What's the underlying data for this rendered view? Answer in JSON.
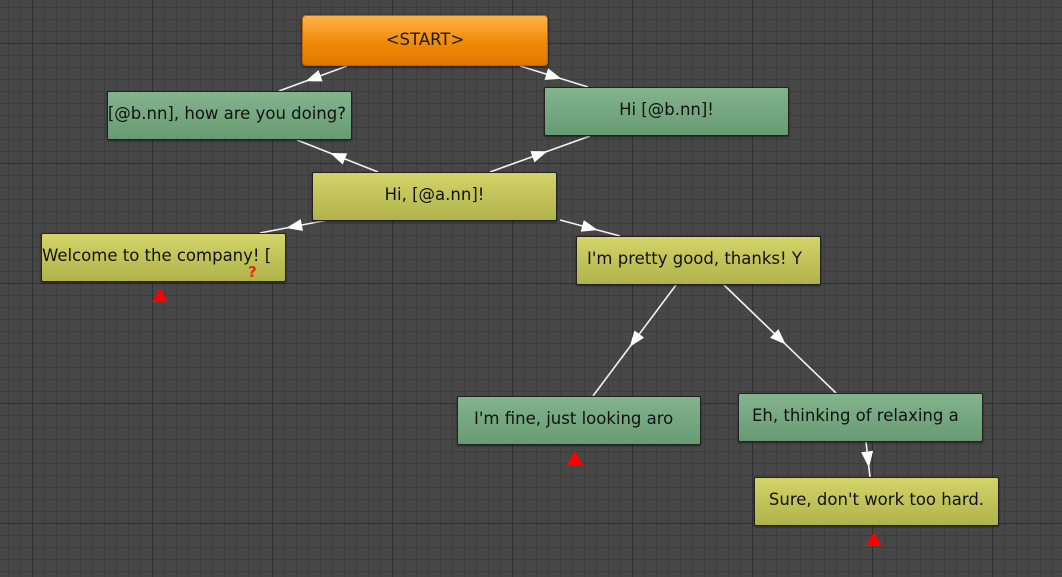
{
  "diagram": {
    "nodes": [
      {
        "id": "start",
        "label": "<START>",
        "kind": "start"
      },
      {
        "id": "n1",
        "label": "Hey [@b.nn], how are you doing?",
        "kind": "green"
      },
      {
        "id": "n2",
        "label": "Hi [@b.nn]!",
        "kind": "green"
      },
      {
        "id": "n3",
        "label": "Hi, [@a.nn]!",
        "kind": "yellow"
      },
      {
        "id": "n4",
        "label": "Welcome to the company! [",
        "kind": "yellow"
      },
      {
        "id": "n5",
        "label": "I'm pretty good, thanks! Y",
        "kind": "yellow"
      },
      {
        "id": "n6",
        "label": "I'm fine, just looking aro",
        "kind": "green"
      },
      {
        "id": "n7",
        "label": "Eh, thinking of relaxing a",
        "kind": "green"
      },
      {
        "id": "n8",
        "label": "Sure, don't work too hard.",
        "kind": "yellow"
      }
    ],
    "edges": [
      {
        "from": "n1",
        "to": "start"
      },
      {
        "from": "n2",
        "to": "start"
      },
      {
        "from": "n3",
        "to": "n1"
      },
      {
        "from": "n3",
        "to": "n2"
      },
      {
        "from": "n3",
        "to": "n4"
      },
      {
        "from": "n3",
        "to": "n5"
      },
      {
        "from": "n5",
        "to": "n6"
      },
      {
        "from": "n5",
        "to": "n7"
      },
      {
        "from": "n7",
        "to": "n8"
      }
    ],
    "markers": {
      "question_symbol": "?",
      "colors": {
        "warning": "#ff0000",
        "question": "#e22a0c"
      }
    }
  }
}
